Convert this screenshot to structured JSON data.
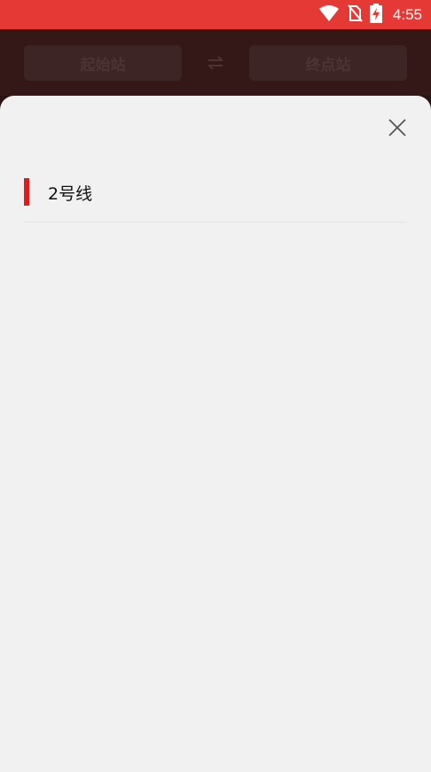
{
  "status_bar": {
    "time": "4:55",
    "icons": [
      "wifi-icon",
      "no-sim-icon",
      "battery-charging-icon"
    ],
    "background_color": "#e53935"
  },
  "app_bar": {
    "start_station_label": "起始站",
    "end_station_label": "终点站",
    "swap_symbol": "⇌",
    "swap_icon": "swap-icon"
  },
  "sheet": {
    "close_icon": "close-icon",
    "lines": [
      {
        "label": "2号线",
        "color": "#e01b1b"
      }
    ]
  }
}
